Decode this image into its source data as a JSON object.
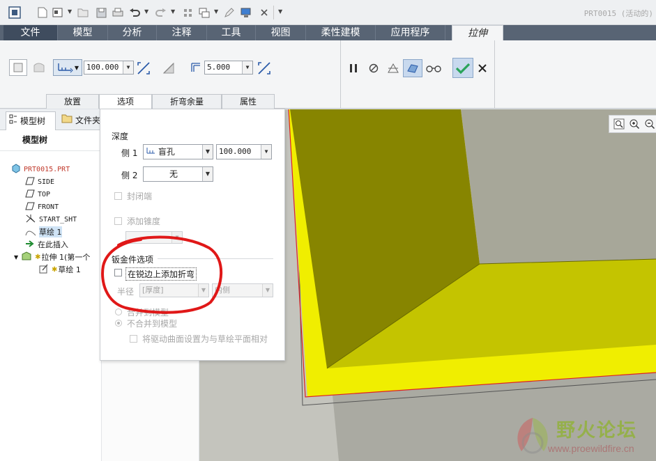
{
  "window": {
    "title": "PRT0015 (活动的)"
  },
  "ribbon": {
    "tabs": [
      {
        "label": "文件"
      },
      {
        "label": "模型"
      },
      {
        "label": "分析"
      },
      {
        "label": "注释"
      },
      {
        "label": "工具"
      },
      {
        "label": "视图"
      },
      {
        "label": "柔性建模"
      },
      {
        "label": "应用程序"
      },
      {
        "label": "拉伸"
      }
    ]
  },
  "dashboard": {
    "depth_value": "100.000",
    "thickness_value": "5.000",
    "subtabs": [
      {
        "label": "放置"
      },
      {
        "label": "选项"
      },
      {
        "label": "折弯余量"
      },
      {
        "label": "属性"
      }
    ],
    "active_subtab": "选项",
    "accent_color": "#2aa35a"
  },
  "nav": {
    "tabs": [
      {
        "label": "模型树"
      },
      {
        "label": "文件夹"
      }
    ],
    "tree_header": "模型树"
  },
  "tree": {
    "items": [
      {
        "label": "PRT0015.PRT"
      },
      {
        "label": "SIDE"
      },
      {
        "label": "TOP"
      },
      {
        "label": "FRONT"
      },
      {
        "label": "START_SHT"
      },
      {
        "label": "草绘 1"
      },
      {
        "label": "在此插入"
      },
      {
        "label": "拉伸 1(第一个"
      },
      {
        "label": "草绘 1"
      }
    ]
  },
  "options_panel": {
    "depth_title": "深度",
    "side1_label": "侧 1",
    "side1_type": "盲孔",
    "side1_value": "100.000",
    "side2_label": "侧 2",
    "side2_type": "无",
    "capped_ends": "封闭端",
    "add_taper": "添加锥度",
    "sheetmetal_title": "钣金件选项",
    "add_bends": "在锐边上添加折弯",
    "radius_label": "半径",
    "radius_value": "[厚度]",
    "radius_side": "内侧",
    "merge_model": "合并到模型",
    "no_merge_model": "不合并到模型",
    "drive_surface": "将驱动曲面设置为与草绘平面相对"
  },
  "watermark": {
    "text": "野火论坛",
    "url": "www.proewildfire.cn"
  },
  "colors": {
    "annotation_circle": "#e01818",
    "part_yellow": "#f0ee00",
    "part_olive": "#878500",
    "part_face": "#c4c400"
  }
}
